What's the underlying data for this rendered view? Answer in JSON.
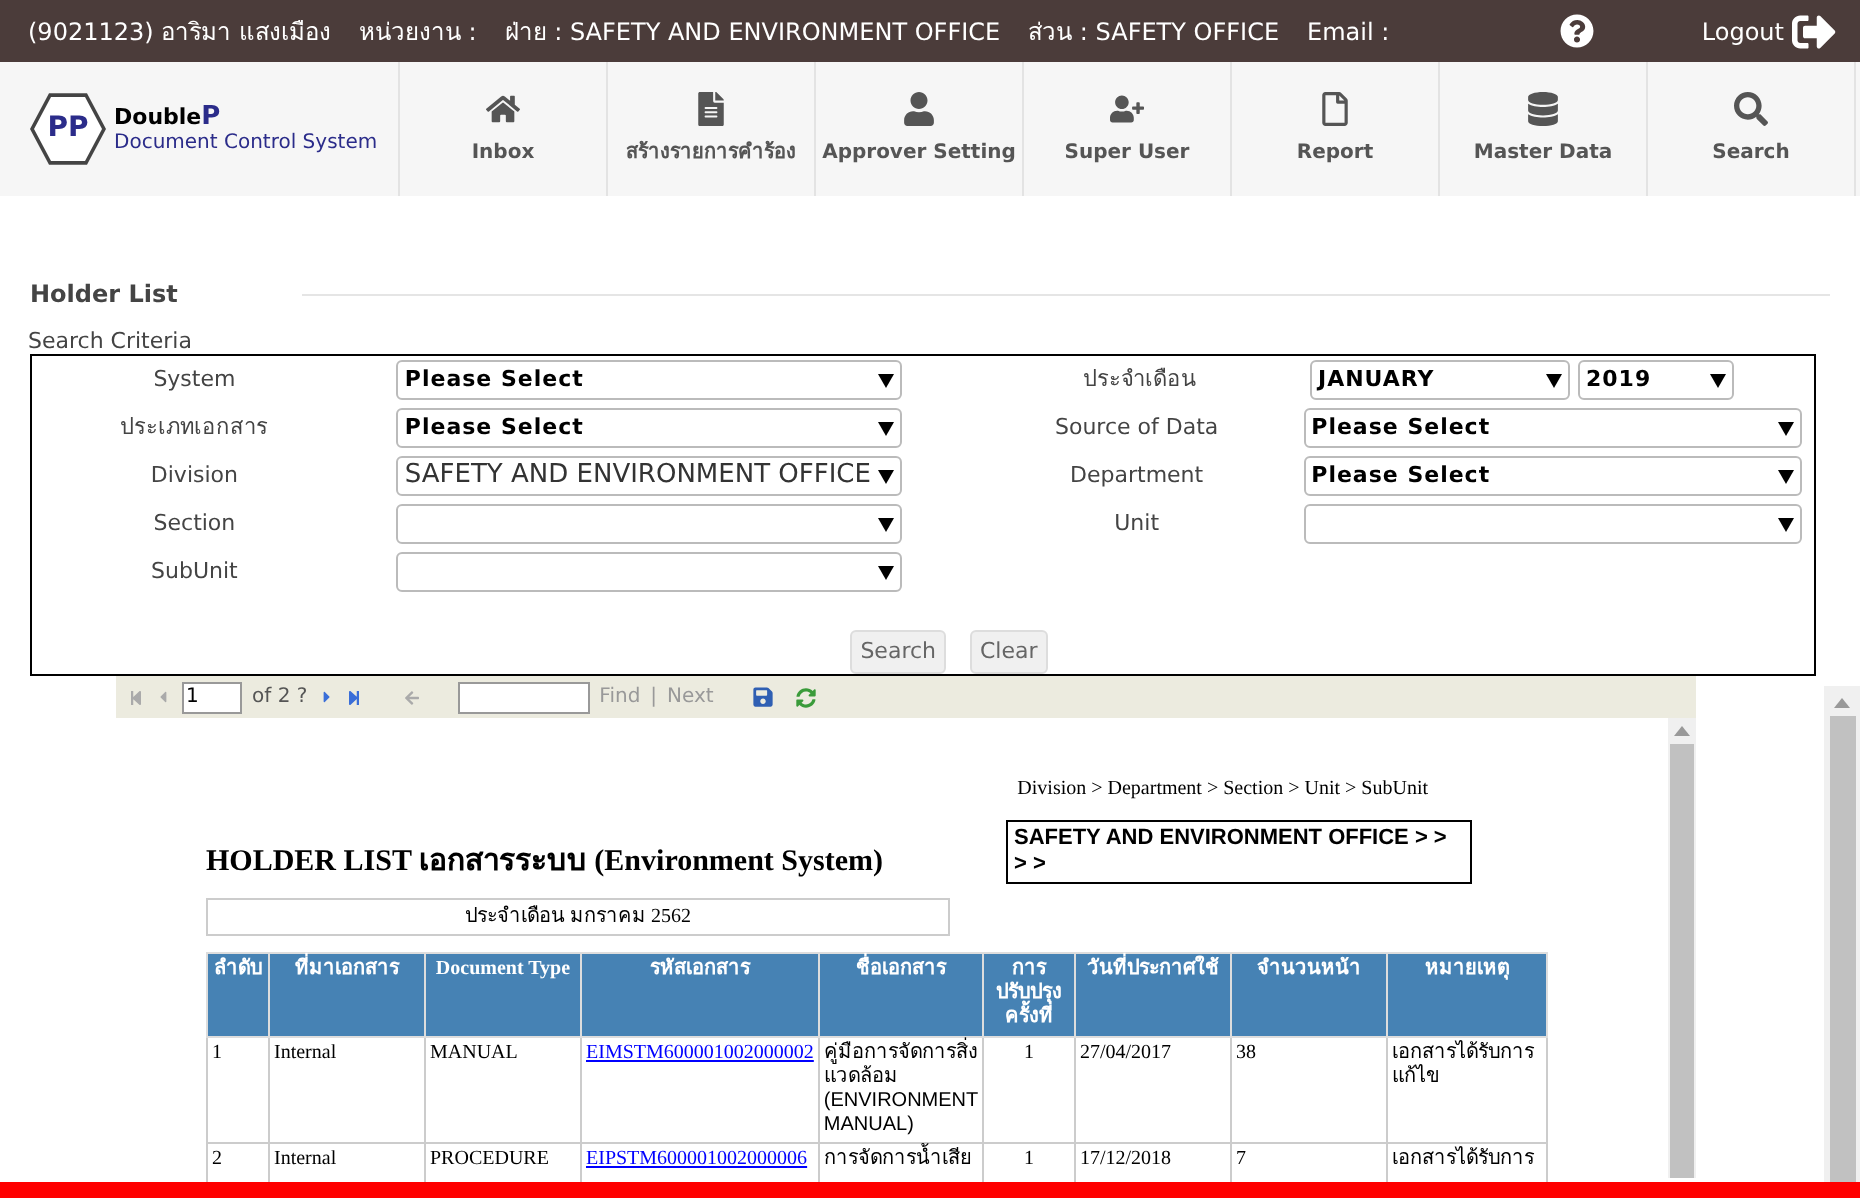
{
  "top_bar": {
    "user": "(9021123) อาริมา แสงเมือง",
    "unit_label": "หน่วยงาน :",
    "division": "ฝ่าย : SAFETY AND ENVIRONMENT OFFICE",
    "section": "ส่วน : SAFETY OFFICE",
    "email": "Email :",
    "logout": "Logout"
  },
  "logo": {
    "mark": "PP",
    "brand": "Double",
    "brand_end": "P",
    "subtitle": "Document Control System"
  },
  "nav": [
    {
      "label": "Inbox",
      "kind": "home"
    },
    {
      "label": "สร้างรายการคำร้อง",
      "kind": "file"
    },
    {
      "label": "Approver Setting",
      "kind": "user"
    },
    {
      "label": "Super User",
      "kind": "user-plus"
    },
    {
      "label": "Report",
      "kind": "page"
    },
    {
      "label": "Master Data",
      "kind": "database"
    },
    {
      "label": "Search",
      "kind": "search"
    }
  ],
  "page_title": "Holder List",
  "criteria_title": "Search Criteria",
  "field_rows": [
    {
      "left": {
        "label": "System",
        "value": "Please Select"
      },
      "right": {
        "label": "ประจำเดือน",
        "value": "JANUARY",
        "value2": "2019"
      }
    },
    {
      "left": {
        "label": "ประเภทเอกสาร",
        "value": "Please Select"
      },
      "right": {
        "label": "Source of Data",
        "value": "Please Select"
      }
    },
    {
      "left": {
        "label": "Division",
        "value": "SAFETY AND ENVIRONMENT OFFICE",
        "large": true
      },
      "right": {
        "label": "Department",
        "value": "Please Select"
      }
    },
    {
      "left": {
        "label": "Section"
      },
      "right": {
        "label": "Unit"
      }
    },
    {
      "left": {
        "label": "SubUnit"
      }
    }
  ],
  "buttons": [
    "Search",
    "Clear"
  ],
  "viewer": {
    "page": "1",
    "of": "of 2 ?",
    "find": "Find",
    "sep": "|",
    "next": "Next"
  },
  "report": {
    "path": "Division > Department > Section > Unit > SubUnit",
    "title": "HOLDER LIST เอกสารระบบ (Environment System)",
    "selection": "SAFETY AND ENVIRONMENT OFFICE >  >  > >",
    "month": "ประจำเดือน มกราคม 2562",
    "columns": [
      "ลำดับ",
      "ที่มาเอกสาร",
      "Document Type",
      "รหัสเอกสาร",
      "ชื่อเอกสาร",
      "การปรับปรุงครั้งที่",
      "วันที่ประกาศใช้",
      "จำนวนหน้า",
      "หมายเหตุ"
    ],
    "rows": [
      [
        "1",
        "Internal",
        "MANUAL",
        "EIMSTM600001002000002",
        "คู่มือการจัดการสิ่งแวดล้อม (ENVIRONMENT MANUAL)",
        "1",
        "27/04/2017",
        "38",
        "เอกสารได้รับการแก้ไข"
      ],
      [
        "2",
        "Internal",
        "PROCEDURE",
        "EIPSTM600001002000006",
        "การจัดการน้ำเสีย",
        "1",
        "17/12/2018",
        "7",
        "เอกสารได้รับการ"
      ]
    ]
  }
}
